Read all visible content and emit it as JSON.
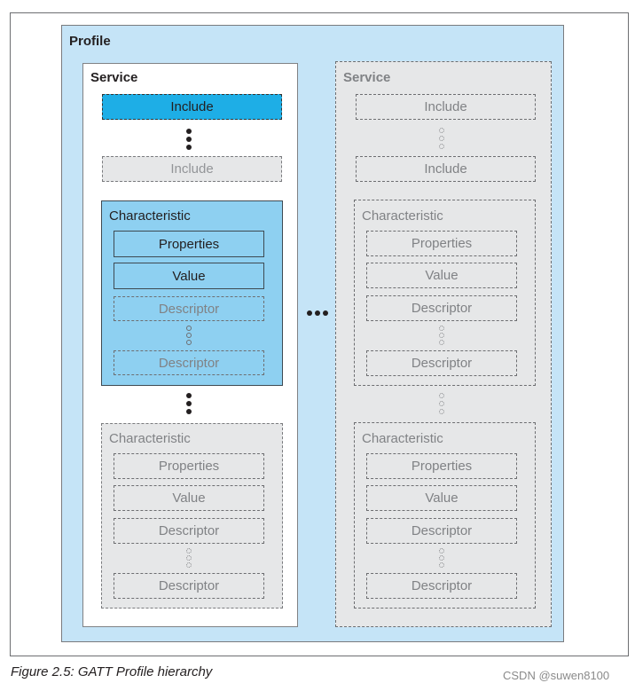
{
  "diagram": {
    "profile_label": "Profile",
    "service_primary": {
      "label": "Service",
      "includes": [
        "Include",
        "Include"
      ],
      "characteristic_primary": {
        "label": "Characteristic",
        "properties": "Properties",
        "value": "Value",
        "descriptors": [
          "Descriptor",
          "Descriptor"
        ]
      },
      "characteristic_secondary": {
        "label": "Characteristic",
        "properties": "Properties",
        "value": "Value",
        "descriptors": [
          "Descriptor",
          "Descriptor"
        ]
      }
    },
    "service_secondary": {
      "label": "Service",
      "includes": [
        "Include",
        "Include"
      ],
      "characteristics": [
        {
          "label": "Characteristic",
          "properties": "Properties",
          "value": "Value",
          "descriptors": [
            "Descriptor",
            "Descriptor"
          ]
        },
        {
          "label": "Characteristic",
          "properties": "Properties",
          "value": "Value",
          "descriptors": [
            "Descriptor",
            "Descriptor"
          ]
        }
      ]
    },
    "colors": {
      "profile_bg": "#c5e4f7",
      "include_active": "#1eaee6",
      "characteristic_active": "#8ed0f1",
      "inactive_bg": "#e6e7e8"
    }
  },
  "caption": "Figure 2.5:  GATT Profile hierarchy",
  "watermark": "CSDN @suwen8100"
}
